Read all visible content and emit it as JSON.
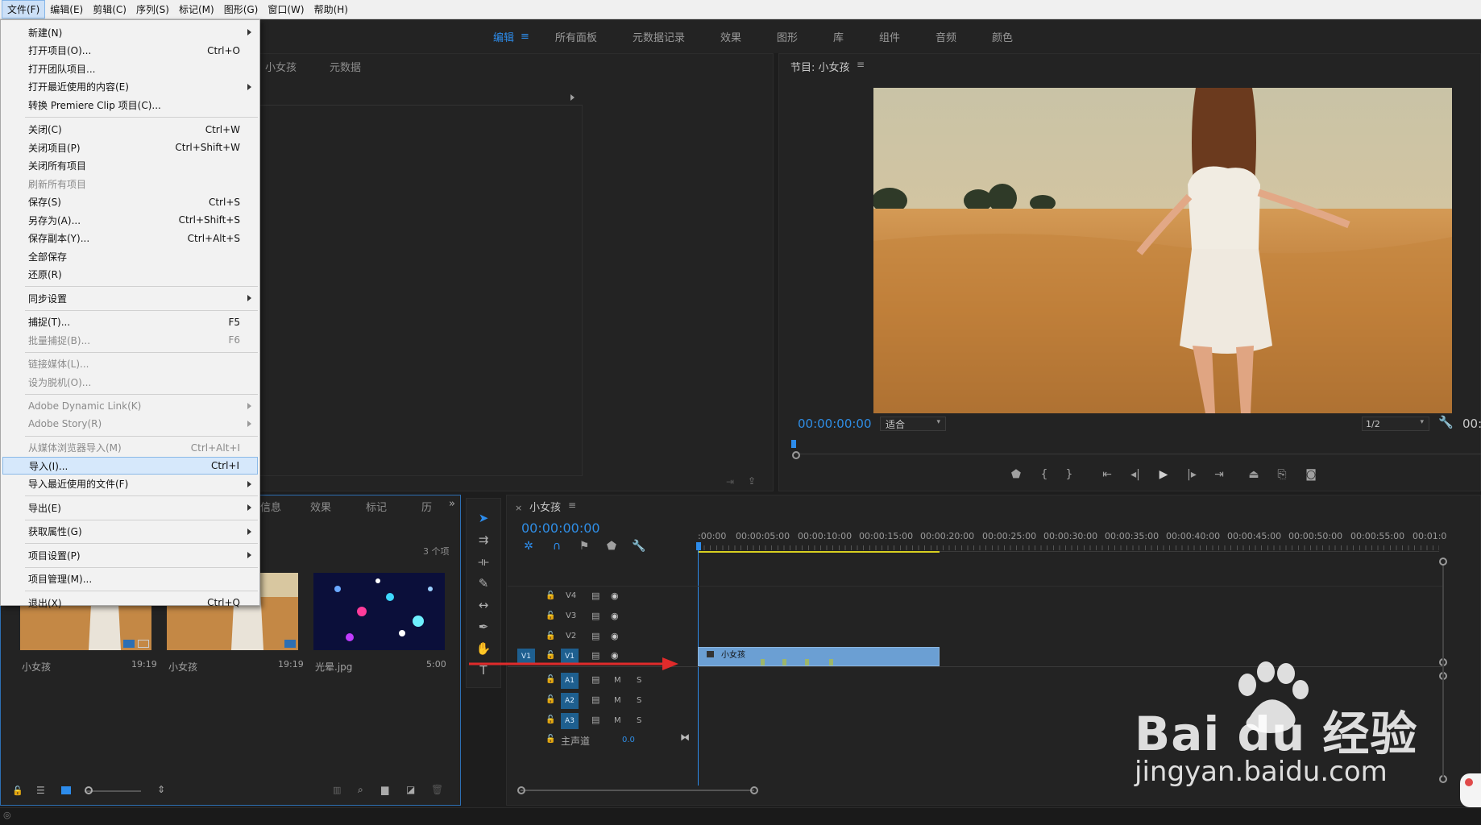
{
  "menubar": {
    "items": [
      "文件(F)",
      "编辑(E)",
      "剪辑(C)",
      "序列(S)",
      "标记(M)",
      "图形(G)",
      "窗口(W)",
      "帮助(H)"
    ]
  },
  "workspaces": {
    "items": [
      "编辑",
      "所有面板",
      "元数据记录",
      "效果",
      "图形",
      "库",
      "组件",
      "音频",
      "颜色"
    ],
    "active": "编辑"
  },
  "file_menu": {
    "items": [
      {
        "label": "新建(N)",
        "shortcut": "",
        "submenu": true,
        "disabled": false
      },
      {
        "label": "打开项目(O)...",
        "shortcut": "Ctrl+O",
        "submenu": false,
        "disabled": false
      },
      {
        "label": "打开团队项目...",
        "shortcut": "",
        "submenu": false,
        "disabled": false
      },
      {
        "label": "打开最近使用的内容(E)",
        "shortcut": "",
        "submenu": true,
        "disabled": false
      },
      {
        "label": "转换 Premiere Clip 项目(C)...",
        "shortcut": "",
        "submenu": false,
        "disabled": false
      },
      {
        "label": "关闭(C)",
        "shortcut": "Ctrl+W",
        "submenu": false,
        "disabled": false
      },
      {
        "label": "关闭项目(P)",
        "shortcut": "Ctrl+Shift+W",
        "submenu": false,
        "disabled": false
      },
      {
        "label": "关闭所有项目",
        "shortcut": "",
        "submenu": false,
        "disabled": false
      },
      {
        "label": "刷新所有项目",
        "shortcut": "",
        "submenu": false,
        "disabled": true
      },
      {
        "label": "保存(S)",
        "shortcut": "Ctrl+S",
        "submenu": false,
        "disabled": false
      },
      {
        "label": "另存为(A)...",
        "shortcut": "Ctrl+Shift+S",
        "submenu": false,
        "disabled": false
      },
      {
        "label": "保存副本(Y)...",
        "shortcut": "Ctrl+Alt+S",
        "submenu": false,
        "disabled": false
      },
      {
        "label": "全部保存",
        "shortcut": "",
        "submenu": false,
        "disabled": false
      },
      {
        "label": "还原(R)",
        "shortcut": "",
        "submenu": false,
        "disabled": false
      },
      {
        "label": "同步设置",
        "shortcut": "",
        "submenu": true,
        "disabled": false
      },
      {
        "label": "捕捉(T)...",
        "shortcut": "F5",
        "submenu": false,
        "disabled": false
      },
      {
        "label": "批量捕捉(B)...",
        "shortcut": "F6",
        "submenu": false,
        "disabled": true
      },
      {
        "label": "链接媒体(L)...",
        "shortcut": "",
        "submenu": false,
        "disabled": true
      },
      {
        "label": "设为脱机(O)...",
        "shortcut": "",
        "submenu": false,
        "disabled": true
      },
      {
        "label": "Adobe Dynamic Link(K)",
        "shortcut": "",
        "submenu": true,
        "disabled": true
      },
      {
        "label": "Adobe Story(R)",
        "shortcut": "",
        "submenu": true,
        "disabled": true
      },
      {
        "label": "从媒体浏览器导入(M)",
        "shortcut": "Ctrl+Alt+I",
        "submenu": false,
        "disabled": true
      },
      {
        "label": "导入(I)...",
        "shortcut": "Ctrl+I",
        "submenu": false,
        "disabled": false,
        "highlighted": true
      },
      {
        "label": "导入最近使用的文件(F)",
        "shortcut": "",
        "submenu": true,
        "disabled": false
      },
      {
        "label": "导出(E)",
        "shortcut": "",
        "submenu": true,
        "disabled": false
      },
      {
        "label": "获取属性(G)",
        "shortcut": "",
        "submenu": true,
        "disabled": false
      },
      {
        "label": "项目设置(P)",
        "shortcut": "",
        "submenu": true,
        "disabled": false
      },
      {
        "label": "项目管理(M)...",
        "shortcut": "",
        "submenu": false,
        "disabled": false
      },
      {
        "label": "退出(X)",
        "shortcut": "Ctrl+Q",
        "submenu": false,
        "disabled": false
      }
    ]
  },
  "source_panel": {
    "tabs": [
      "小女孩",
      "元数据"
    ]
  },
  "program_monitor": {
    "title": "节目: 小女孩",
    "timecode": "00:00:00:00",
    "fit": "适合",
    "resolution": "1/2",
    "end_timecode": "00:"
  },
  "project_panel": {
    "tabs": [
      "信息",
      "效果",
      "标记",
      "历"
    ],
    "item_count": "3 个项",
    "items": [
      {
        "name": "小女孩",
        "duration": "19:19"
      },
      {
        "name": "小女孩",
        "duration": "19:19"
      },
      {
        "name": "光晕.jpg",
        "duration": "5:00"
      }
    ]
  },
  "timeline": {
    "sequence_name": "小女孩",
    "timecode": "00:00:00:00",
    "ruler_labels": [
      ":00:00",
      "00:00:05:00",
      "00:00:10:00",
      "00:00:15:00",
      "00:00:20:00",
      "00:00:25:00",
      "00:00:30:00",
      "00:00:35:00",
      "00:00:40:00",
      "00:00:45:00",
      "00:00:50:00",
      "00:00:55:00",
      "00:01:0"
    ],
    "video_tracks": [
      "V4",
      "V3",
      "V2",
      "V1"
    ],
    "source_patch": "V1",
    "audio_tracks": [
      "A1",
      "A2",
      "A3"
    ],
    "mute_label": "M",
    "solo_label": "S",
    "master_label": "主声道",
    "master_value": "0.0",
    "clip_name": "小女孩"
  },
  "watermark": {
    "brand": "Bai du 经验",
    "url": "jingyan.baidu.com"
  },
  "colors": {
    "accent_blue": "#2d8ceb",
    "clip_blue": "#6b9fd3",
    "arrow_red": "#e02b2b",
    "work_area_yellow": "#d8d020"
  }
}
